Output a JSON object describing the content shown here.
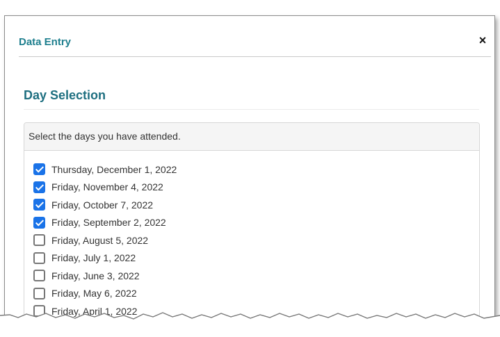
{
  "modal": {
    "title": "Data Entry",
    "close_glyph": "×"
  },
  "section": {
    "title": "Day Selection"
  },
  "panel": {
    "instruction": "Select the days you have attended."
  },
  "days": [
    {
      "label": "Thursday, December 1, 2022",
      "checked": true
    },
    {
      "label": "Friday, November 4, 2022",
      "checked": true
    },
    {
      "label": "Friday, October 7, 2022",
      "checked": true
    },
    {
      "label": "Friday, September 2, 2022",
      "checked": true
    },
    {
      "label": "Friday, August 5, 2022",
      "checked": false
    },
    {
      "label": "Friday, July 1, 2022",
      "checked": false
    },
    {
      "label": "Friday, June 3, 2022",
      "checked": false
    },
    {
      "label": "Friday, May 6, 2022",
      "checked": false
    },
    {
      "label": "Friday, April 1, 2022",
      "checked": false
    }
  ],
  "colors": {
    "title": "#1e7f8e",
    "checkbox_checked": "#1a73e8"
  }
}
